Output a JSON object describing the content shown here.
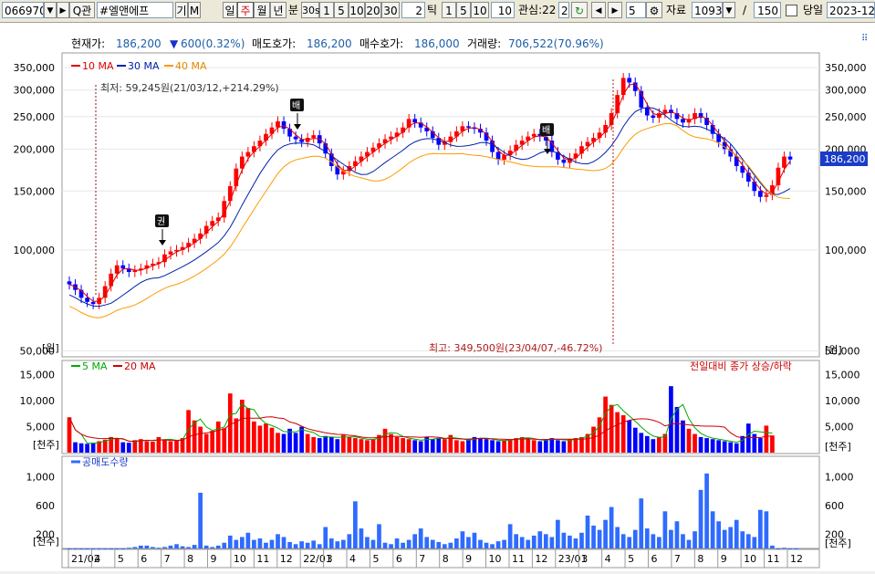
{
  "toolbar": {
    "code": "066970",
    "search_glyph": "Q",
    "search_label": "관",
    "name": "#엘앤에프",
    "btn_gi": "기",
    "btn_m": "M",
    "periods": [
      "일",
      "주",
      "월",
      "년"
    ],
    "period_selected": "주",
    "unit_label": "분",
    "minute_options": [
      "30s",
      "1",
      "5",
      "10",
      "20",
      "30"
    ],
    "tick_value": "2",
    "tick_label": "틱",
    "tick_options": [
      "1",
      "5",
      "10"
    ],
    "count_value": "10",
    "interest_label": "관심:22",
    "interest_value": "2",
    "step_value": "5",
    "data_label": "자료",
    "data_value": "1093",
    "slash": "/",
    "page_total": "150",
    "sameday_label": "당일",
    "date_value": "2023-12-"
  },
  "info": {
    "price_label": "현재가:",
    "price_value": "186,200",
    "change_arrow": "▼",
    "change_value": "600(0.32%)",
    "ask_label": "매도호가:",
    "ask_value": "186,200",
    "bid_label": "매수호가:",
    "bid_value": "186,000",
    "volume_label": "거래량:",
    "volume_value": "706,522(70.96%)"
  },
  "colors": {
    "up": "#ff0000",
    "down": "#0000ff",
    "ma10": "#e00000",
    "ma30": "#0022aa",
    "ma40": "#ff9900",
    "ma5vol": "#00aa00",
    "ma20vol": "#cc0000",
    "short": "#2f6bff",
    "price_box": "#1a3cc8"
  },
  "price_panel": {
    "legend": [
      "10 MA",
      "30 MA",
      "40 MA"
    ],
    "y_ticks": [
      "350,000",
      "300,000",
      "250,000",
      "200,000",
      "150,000",
      "100,000",
      "50,000"
    ],
    "y_values": [
      350000,
      300000,
      250000,
      200000,
      150000,
      100000,
      50000
    ],
    "unit": "[원]",
    "min_annotation": "최저: 59,245원(21/03/12,+214.29%)",
    "max_annotation": "최고: 349,500원(23/04/07,-46.72%)",
    "current_price_box": "186,200",
    "signal_labels": [
      "권",
      "배",
      "배"
    ],
    "ylim": [
      48000,
      380000
    ],
    "log_scale": true
  },
  "volume_panel": {
    "legend": [
      "5 MA",
      "20 MA"
    ],
    "right_caption": "전일대비 종가 상승/하락",
    "y_ticks": [
      "15,000",
      "10,000",
      "5,000"
    ],
    "y_values": [
      15000,
      10000,
      5000
    ],
    "unit": "[천주]",
    "ylim": [
      0,
      16000
    ]
  },
  "short_panel": {
    "legend": "공매도수량",
    "y_ticks": [
      "1,000",
      "600",
      "200"
    ],
    "y_values": [
      1000,
      600,
      200
    ],
    "unit": "[천주]",
    "ylim": [
      0,
      1150
    ]
  },
  "x_axis": {
    "labels": [
      "21/02",
      "4",
      "5",
      "6",
      "7",
      "8",
      "9",
      "10",
      "11",
      "12",
      "22/01",
      "3",
      "4",
      "5",
      "6",
      "7",
      "8",
      "9",
      "10",
      "11",
      "12",
      "23/01",
      "3",
      "4",
      "5",
      "6",
      "7",
      "8",
      "9",
      "10",
      "11",
      "12"
    ]
  },
  "chart_data": {
    "type": "candlestick",
    "title": "",
    "series": [
      {
        "name": "10 MA",
        "values": []
      },
      {
        "name": "30 MA",
        "values": []
      },
      {
        "name": "40 MA",
        "values": []
      }
    ],
    "close": [
      79000,
      76000,
      72000,
      70000,
      69000,
      72000,
      78000,
      85000,
      90000,
      88000,
      86000,
      87000,
      88000,
      90000,
      91000,
      92000,
      97000,
      99000,
      100000,
      102000,
      105000,
      108000,
      112000,
      118000,
      122000,
      125000,
      140000,
      155000,
      175000,
      190000,
      196000,
      204000,
      212000,
      222000,
      232000,
      242000,
      230000,
      218000,
      214000,
      210000,
      216000,
      220000,
      208000,
      194000,
      178000,
      168000,
      172000,
      178000,
      184000,
      190000,
      196000,
      202000,
      208000,
      214000,
      218000,
      224000,
      232000,
      246000,
      240000,
      232000,
      226000,
      216000,
      206000,
      210000,
      218000,
      226000,
      234000,
      232000,
      230000,
      224000,
      212000,
      196000,
      186000,
      192000,
      198000,
      206000,
      212000,
      218000,
      222000,
      218000,
      212000,
      196000,
      186000,
      182000,
      188000,
      194000,
      204000,
      210000,
      216000,
      224000,
      236000,
      256000,
      290000,
      326000,
      316000,
      298000,
      266000,
      252000,
      248000,
      256000,
      262000,
      256000,
      246000,
      240000,
      246000,
      256000,
      248000,
      236000,
      222000,
      210000,
      200000,
      190000,
      178000,
      170000,
      160000,
      150000,
      144000,
      146000,
      156000,
      176000,
      190000,
      186200
    ],
    "volume": [
      6800,
      2000,
      1800,
      1700,
      1900,
      2200,
      2500,
      3000,
      2800,
      2000,
      1900,
      2400,
      2600,
      2200,
      2100,
      3000,
      2500,
      2200,
      2400,
      2800,
      8200,
      6200,
      5000,
      3600,
      4200,
      6000,
      4700,
      11400,
      6600,
      10200,
      8600,
      6000,
      5200,
      5600,
      4800,
      3800,
      3600,
      4600,
      3800,
      5000,
      3600,
      3000,
      2800,
      3200,
      3000,
      2600,
      3400,
      3000,
      2800,
      2600,
      2400,
      2600,
      3400,
      4600,
      3600,
      3000,
      2800,
      2600,
      2400,
      2200,
      3000,
      2600,
      2800,
      2600,
      3400,
      2400,
      2200,
      2600,
      3000,
      2800,
      2600,
      2400,
      2200,
      2400,
      2600,
      2800,
      3000,
      2800,
      2400,
      2200,
      2600,
      2800,
      2400,
      2200,
      2600,
      2800,
      3000,
      3600,
      5000,
      6800,
      10800,
      9200,
      7800,
      7200,
      6200,
      4800,
      3800,
      3200,
      2600,
      3000,
      3600,
      12800,
      8800,
      6200,
      4600,
      3600,
      3000,
      2800,
      2600,
      2400,
      2200,
      2000,
      1800,
      3200,
      5600,
      3600,
      2800,
      5200,
      3300
    ],
    "short_volume": [
      0,
      0,
      0,
      0,
      0,
      0,
      0,
      0,
      0,
      0,
      10,
      20,
      40,
      40,
      20,
      10,
      20,
      40,
      60,
      30,
      20,
      50,
      780,
      40,
      20,
      40,
      80,
      180,
      120,
      160,
      220,
      120,
      140,
      80,
      120,
      200,
      160,
      90,
      60,
      100,
      80,
      110,
      60,
      300,
      140,
      100,
      120,
      200,
      660,
      280,
      160,
      120,
      340,
      80,
      60,
      140,
      80,
      120,
      200,
      280,
      160,
      120,
      90,
      60,
      80,
      140,
      240,
      160,
      220,
      120,
      80,
      60,
      100,
      120,
      340,
      200,
      160,
      120,
      180,
      240,
      200,
      160,
      400,
      220,
      180,
      140,
      220,
      460,
      320,
      260,
      400,
      580,
      300,
      200,
      160,
      260,
      700,
      280,
      200,
      160,
      520,
      260,
      380,
      200,
      120,
      240,
      820,
      1050,
      520,
      380,
      260,
      300,
      400,
      240,
      200,
      160,
      540,
      520,
      40,
      0,
      10,
      0,
      0
    ]
  }
}
